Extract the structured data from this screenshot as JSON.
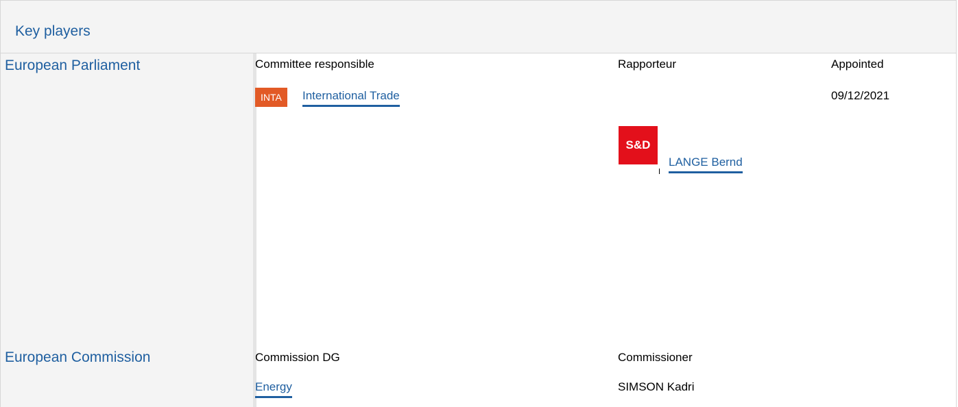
{
  "section": {
    "title": "Key players"
  },
  "parliament": {
    "name": "European Parliament",
    "committee_header": "Committee responsible",
    "rapporteur_header": "Rapporteur",
    "appointed_header": "Appointed",
    "committee_badge": "INTA",
    "committee_name": "International Trade",
    "group_logo": "S&D",
    "rapporteur_name": "LANGE Bernd",
    "appointed_date": "09/12/2021"
  },
  "commission": {
    "name": "European Commission",
    "dg_header": "Commission DG",
    "commissioner_header": "Commissioner",
    "dg_name": "Energy",
    "commissioner_name": "SIMSON Kadri"
  },
  "colors": {
    "link": "#1f5fa0",
    "badge": "#e25a26",
    "logo": "#e3101b"
  }
}
